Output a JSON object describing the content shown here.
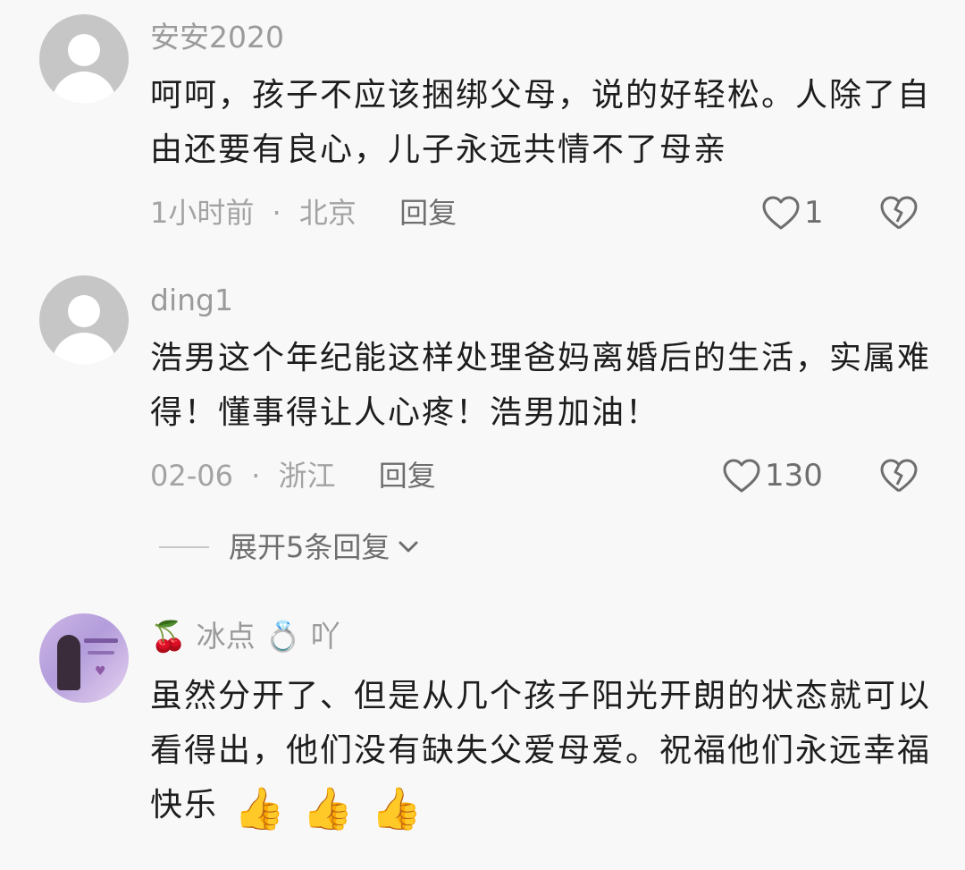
{
  "comments": [
    {
      "username": "安安2020",
      "content": "呵呵，孩子不应该捆绑父母，说的好轻松。人除了自由还要有良心，儿子永远共情不了母亲",
      "time": "1小时前",
      "location": "北京",
      "reply_label": "回复",
      "likes": "1"
    },
    {
      "username": "ding1",
      "content": "浩男这个年纪能这样处理爸妈离婚后的生活，实属难得！懂事得让人心疼！浩男加油！",
      "time": "02-06",
      "location": "浙江",
      "reply_label": "回复",
      "likes": "130",
      "expand_label": "展开5条回复"
    },
    {
      "username_prefix_emoji": "🍒",
      "username_text": "冰点",
      "username_mid_emoji": "💍",
      "username_suffix": "吖",
      "content": "虽然分开了、但是从几个孩子阳光开朗的状态就可以看得出，他们没有缺失父爱母爱。祝福他们永远幸福快乐",
      "content_emoji": [
        "👍",
        "👍",
        "👍"
      ]
    }
  ],
  "separator": "·",
  "icons": {
    "like": "heart-outline-icon",
    "dislike": "broken-heart-icon",
    "expand": "chevron-down-icon"
  },
  "colors": {
    "background": "#f8f8f8",
    "username": "#9b9b9b",
    "meta": "#a3a3a3",
    "action": "#6e6e6e"
  }
}
